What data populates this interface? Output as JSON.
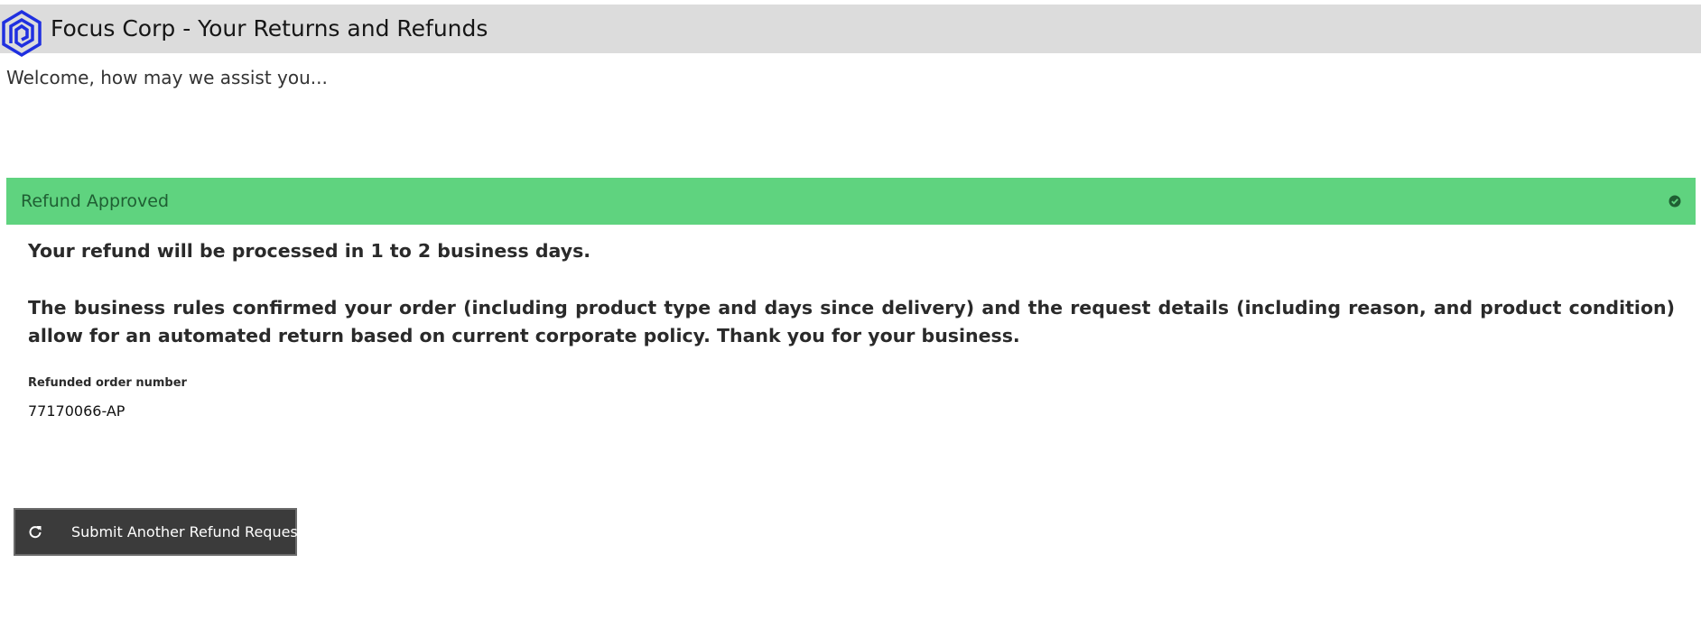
{
  "header": {
    "title": "Focus Corp - Your Returns and Refunds",
    "logo_icon": "hexagon-spiral-logo",
    "logo_color": "#1f2fe0"
  },
  "welcome": {
    "text": "Welcome, how may we assist you..."
  },
  "banner": {
    "title": "Refund Approved",
    "status_icon": "check-circle-icon",
    "color": "#5fd37f"
  },
  "result": {
    "headline": "Your refund will be processed in 1 to 2 business days.",
    "details": "The business rules confirmed your order (including product type and days since delivery) and the request details (including reason, and product condition) allow for an automated return based on current corporate policy. Thank you for your business.",
    "order_label": "Refunded order number",
    "order_number": "77170066-AP"
  },
  "actions": {
    "submit_another_label": "Submit Another Refund Request",
    "submit_another_icon": "refresh-icon"
  }
}
